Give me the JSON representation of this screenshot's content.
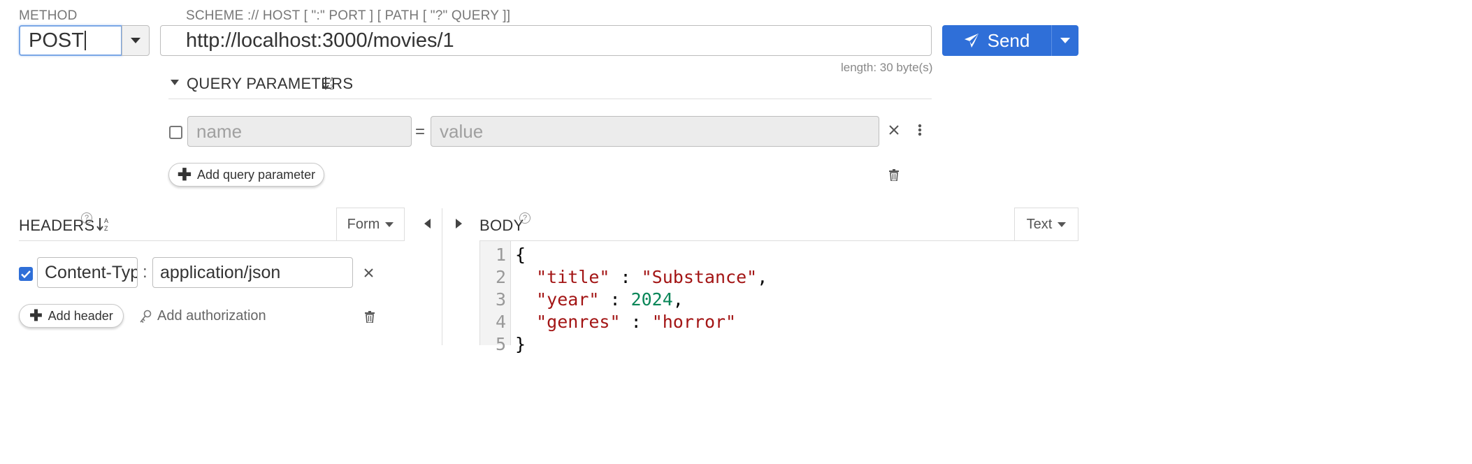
{
  "method": {
    "caption": "METHOD",
    "value": "POST"
  },
  "url": {
    "caption": "SCHEME :// HOST [ \":\" PORT ] [ PATH [ \"?\" QUERY ]]",
    "value": "http://localhost:3000/movies/1",
    "length_text": "length: 30 byte(s)"
  },
  "send": {
    "label": "Send",
    "accent": "#2f6fd8"
  },
  "query": {
    "title": "QUERY PARAMETERS",
    "name_placeholder": "name",
    "value_placeholder": "value",
    "equals": "=",
    "add_label": "Add query parameter"
  },
  "headers": {
    "title": "HEADERS",
    "format": "Form",
    "rows": [
      {
        "enabled": true,
        "name": "Content-Type",
        "separator": ":",
        "value": "application/json"
      }
    ],
    "add_label": "Add header",
    "auth_label": "Add authorization"
  },
  "body": {
    "title": "BODY",
    "format": "Text",
    "line_numbers": [
      "1",
      "2",
      "3",
      "4",
      "5"
    ],
    "code_lines": [
      [
        {
          "t": "{",
          "c": "p"
        }
      ],
      [
        {
          "t": "  ",
          "c": "p"
        },
        {
          "t": "\"title\"",
          "c": "s"
        },
        {
          "t": " : ",
          "c": "p"
        },
        {
          "t": "\"Substance\"",
          "c": "s"
        },
        {
          "t": ",",
          "c": "p"
        }
      ],
      [
        {
          "t": "  ",
          "c": "p"
        },
        {
          "t": "\"year\"",
          "c": "s"
        },
        {
          "t": " : ",
          "c": "p"
        },
        {
          "t": "2024",
          "c": "n"
        },
        {
          "t": ",",
          "c": "p"
        }
      ],
      [
        {
          "t": "  ",
          "c": "p"
        },
        {
          "t": "\"genres\"",
          "c": "s"
        },
        {
          "t": " : ",
          "c": "p"
        },
        {
          "t": "\"horror\"",
          "c": "s"
        }
      ],
      [
        {
          "t": "}",
          "c": "p"
        }
      ]
    ]
  },
  "icons": {
    "dropdown": "caret-down-icon",
    "sort": "sort-alpha-icon",
    "help": "help-circle-icon",
    "trash": "trash-icon",
    "close": "close-icon",
    "more": "more-vertical-icon",
    "paper_plane": "paper-plane-icon",
    "key": "key-icon",
    "plus": "plus-icon"
  }
}
